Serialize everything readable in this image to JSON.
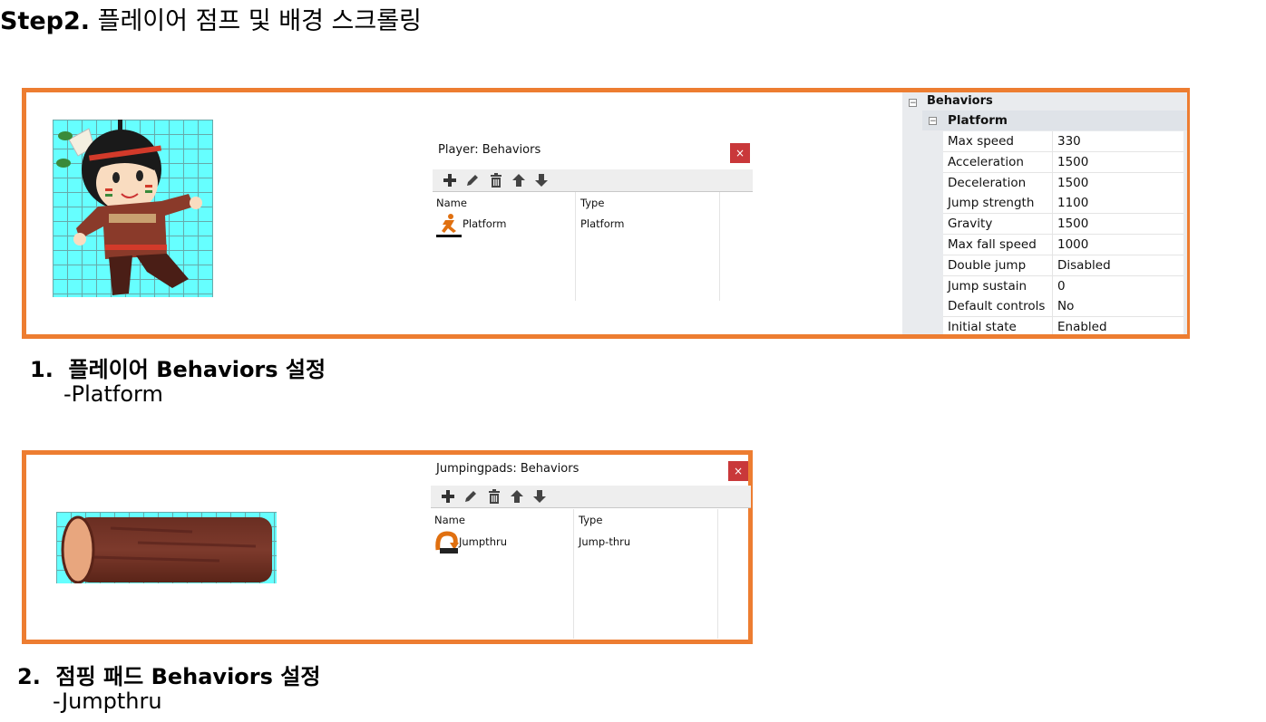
{
  "title": {
    "step": "Step2.",
    "text": " 플레이어 점프 및 배경 스크롤링"
  },
  "player_dialog": {
    "title": "Player: Behaviors",
    "close": "×",
    "columns": [
      "Name",
      "Type"
    ],
    "rows": [
      {
        "icon": "platform-runner-icon",
        "name": "Platform",
        "type": "Platform"
      }
    ]
  },
  "properties": {
    "section": "Behaviors",
    "group": "Platform",
    "rows": [
      {
        "name": "Max speed",
        "value": "330"
      },
      {
        "name": "Acceleration",
        "value": "1500"
      },
      {
        "name": "Deceleration",
        "value": "1500"
      },
      {
        "name": "Jump strength",
        "value": "1100"
      },
      {
        "name": "Gravity",
        "value": "1500"
      },
      {
        "name": "Max fall speed",
        "value": "1000"
      },
      {
        "name": "Double jump",
        "value": "Disabled"
      },
      {
        "name": "Jump sustain",
        "value": "0"
      },
      {
        "name": "Default controls",
        "value": "No"
      },
      {
        "name": "Initial state",
        "value": "Enabled"
      }
    ]
  },
  "caption1": {
    "number": "1.",
    "text": "플레이어 Behaviors 설정",
    "sub": "-Platform"
  },
  "jump_dialog": {
    "title": "Jumpingpads: Behaviors",
    "close": "×",
    "columns": [
      "Name",
      "Type"
    ],
    "rows": [
      {
        "icon": "jumpthru-icon",
        "name": "Jumpthru",
        "type": "Jump-thru"
      }
    ]
  },
  "caption2": {
    "number": "2.",
    "text": "점핑 패드 Behaviors 설정",
    "sub": "-Jumpthru"
  },
  "toolbar_icons": [
    "add-icon",
    "edit-pencil-icon",
    "delete-trash-icon",
    "move-up-icon",
    "move-down-icon"
  ],
  "colors": {
    "frame": "#ed7d31",
    "sprite_bg": "#66ffff",
    "close": "#c9383a"
  }
}
